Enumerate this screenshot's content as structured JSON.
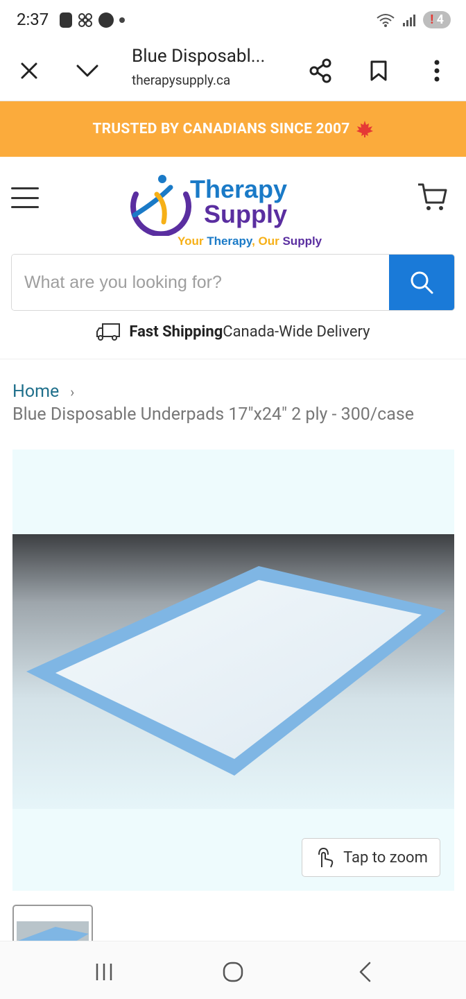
{
  "status_bar": {
    "time": "2:37",
    "notification_count": "4",
    "notification_alert": "!"
  },
  "toolbar": {
    "title": "Blue Disposabl...",
    "url": "therapysupply.ca"
  },
  "promo": {
    "text": "TRUSTED BY CANADIANS SINCE 2007",
    "icon": "maple-leaf-icon"
  },
  "logo": {
    "name_line1": "Therapy",
    "name_line2": "Supply",
    "tagline_part1": "Your ",
    "tagline_part2": "Therapy",
    "tagline_part3": ", Our ",
    "tagline_part4": "Supply"
  },
  "search": {
    "placeholder": "What are you looking for?"
  },
  "shipping": {
    "bold": "Fast Shipping",
    "text": "Canada-Wide Delivery"
  },
  "breadcrumb": {
    "home": "Home",
    "separator": "›",
    "current": "Blue Disposable Underpads 17\"x24\" 2 ply - 300/case"
  },
  "product": {
    "zoom_label": "Tap to zoom"
  },
  "colors": {
    "promo_bg": "#fbab3c",
    "search_button": "#1a7ad8",
    "brand_blue": "#1a7ac7",
    "brand_purple": "#5a2ea0",
    "link": "#1f6f8b"
  }
}
